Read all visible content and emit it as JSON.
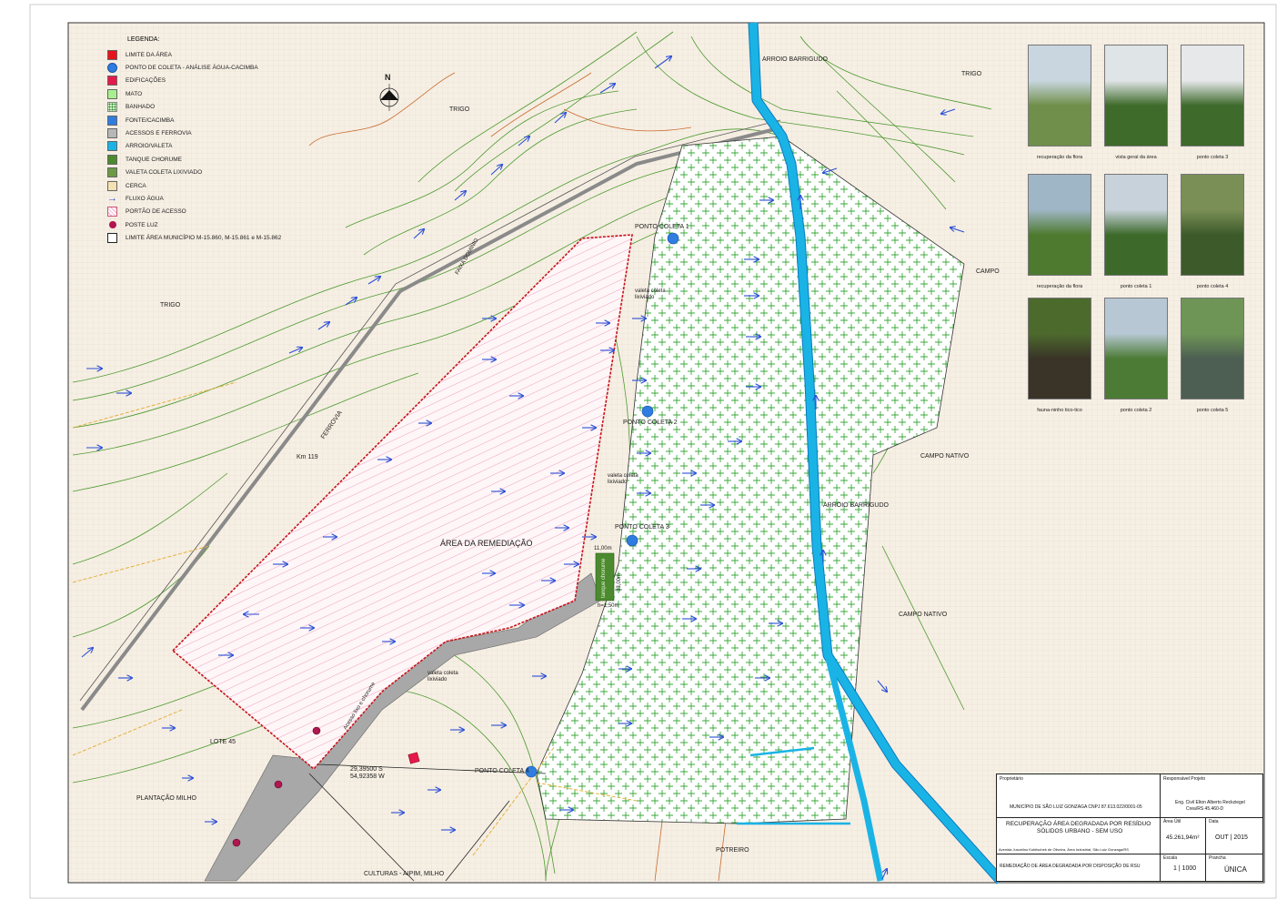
{
  "legend": {
    "title": "LEGENDA:",
    "items": [
      {
        "label": "LIMITE DA ÁREA",
        "color": "#e8141b",
        "shape": "square"
      },
      {
        "label": "PONTO DE COLETA - ANÁLISE ÁGUA-CACIMBA",
        "color": "#2f7de1",
        "shape": "circle"
      },
      {
        "label": "EDIFICAÇÕES",
        "color": "#e6194b",
        "shape": "square"
      },
      {
        "label": "MATO",
        "color": "#a8f08f",
        "shape": "square"
      },
      {
        "label": "BANHADO",
        "color": "#cdeec2",
        "shape": "dots"
      },
      {
        "label": "FONTE/CACIMBA",
        "color": "#2f7de1",
        "shape": "square"
      },
      {
        "label": "ACESSOS E FERROVIA",
        "color": "#b7b7b7",
        "shape": "square"
      },
      {
        "label": "ARROIO/VALETA",
        "color": "#1ab3e6",
        "shape": "square"
      },
      {
        "label": "TANQUE CHORUME",
        "color": "#4b8a2e",
        "shape": "square"
      },
      {
        "label": "VALETA COLETA LIXIVIADO",
        "color": "#6c9a45",
        "shape": "square"
      },
      {
        "label": "CERCA",
        "color": "#f5e2b2",
        "shape": "square"
      },
      {
        "label": "FLUXO ÁGUA",
        "color": "#2a4fd6",
        "shape": "arrow"
      },
      {
        "label": "PORTÃO DE ACESSO",
        "color": "#f4a9c7",
        "shape": "hatch"
      },
      {
        "label": "POSTE LUZ",
        "color": "#b0164f",
        "shape": "dot"
      },
      {
        "label": "LIMITE ÁREA MUNICÍPIO   M-15.860, M-15.861 e M-15.862",
        "color": "#222222",
        "shape": "outline"
      }
    ]
  },
  "map": {
    "north": "N",
    "labels": {
      "arroio_top": "ARROIO BARRIGUDO",
      "trigo_right": "TRIGO",
      "trigo_mid": "TRIGO",
      "trigo_left": "TRIGO",
      "campo": "CAMPO",
      "campo_nativo_1": "CAMPO NATIVO",
      "campo_nativo_2": "CAMPO NATIVO",
      "arroio_mid": "ARROIO BARRIGUDO",
      "ferrovia": "FERROVIA",
      "faixa_dominio": "FAIXA DOMÍNIO",
      "km": "Km 119",
      "remediacao": "ÁREA DA REMEDIAÇÃO",
      "valeta_1": "valeta coleta",
      "valeta_1b": "lixiviado",
      "valeta_2": "valeta coleta",
      "valeta_2b": "lixiviado",
      "valeta_3": "valeta coleta",
      "valeta_3b": "lixiviado",
      "tanque_w": "11,00m",
      "tanque_l": "33,00m",
      "tanque_name": "tanque chorume",
      "tanque_h": "h=1,50m",
      "coord_s": "29,39500 S",
      "coord_w": "54,92358 W",
      "lote": "LOTE 45",
      "plantacao": "PLANTAÇÃO MILHO",
      "culturas": "CULTURAS  -  AIPIM, MILHO",
      "potreiro": "POTREIRO",
      "acesso": "Acesso lixo e chorume"
    },
    "points": [
      {
        "label": "PONTO COLETA 1"
      },
      {
        "label": "PONTO COLETA 2"
      },
      {
        "label": "PONTO COLETA 3"
      },
      {
        "label": "PONTO COLETA 4"
      }
    ]
  },
  "photos": [
    {
      "caption": "recuperação da flora",
      "sky": "#c9d6e0",
      "ground": "#6f8f4a"
    },
    {
      "caption": "vista geral da área",
      "sky": "#dfe4e6",
      "ground": "#3f6b2a"
    },
    {
      "caption": "ponto coleta 3",
      "sky": "#e6e8ea",
      "ground": "#3e6a2c"
    },
    {
      "caption": "recuperação da flora",
      "sky": "#9fb6c6",
      "ground": "#4e7a30"
    },
    {
      "caption": "ponto coleta 1",
      "sky": "#c8d2da",
      "ground": "#3d6a2b"
    },
    {
      "caption": "ponto coleta 4",
      "sky": "#7a8f56",
      "ground": "#3c5a2a"
    },
    {
      "caption": "fauna-ninho tico-tico",
      "sky": "#4d6a2d",
      "ground": "#3a3428"
    },
    {
      "caption": "ponto coleta 2",
      "sky": "#b7c8d4",
      "ground": "#4c7b35"
    },
    {
      "caption": "ponto coleta 5",
      "sky": "#6e9556",
      "ground": "#4d5f52"
    }
  ],
  "titleblock": {
    "proprietario_h": "Proprietário",
    "proprietario": "MUNICÍPIO DE SÃO LUIZ GONZAGA   CNPJ 87.613.022/0001-05",
    "responsavel_h": "Responsável Projeto",
    "responsavel": "Eng. Civil Elton Alberto Reckziegel",
    "crea": "Crea/RS 45.460-D",
    "titulo1": "RECUPERAÇÃO ÁREA DEGRADADA POR RESÍDUO",
    "titulo2": "SÓLIDOS URBANO - SEM USO",
    "endereco": "Avenida Juscelino Kubitschek de Oliveira, Área Industrial, São Luiz Gonzaga/RS",
    "area_h": "Área Útil",
    "area": "45.261,94m²",
    "data_h": "Data",
    "data": "OUT | 2015",
    "descricao": "REMEDIAÇÃO DE ÁREA DEGRADADA POR DISPOSIÇÃO DE RSU",
    "escala_h": "Escala",
    "escala": "1 | 1000",
    "prancha_h": "Prancha",
    "prancha": "ÚNICA"
  }
}
